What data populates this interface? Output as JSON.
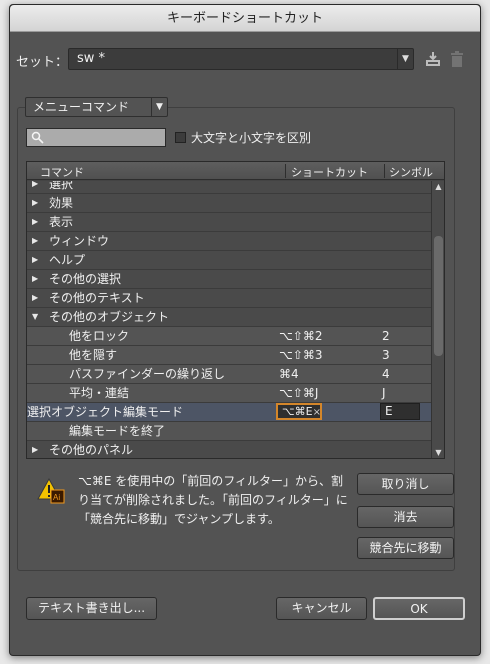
{
  "window": {
    "title": "キーボードショートカット"
  },
  "set": {
    "label": "セット：",
    "value": "sw *"
  },
  "menu_dropdown": {
    "value": "メニューコマンド"
  },
  "search": {
    "placeholder": ""
  },
  "case_checkbox": {
    "label": "大文字と小文字を区別",
    "checked": false
  },
  "table": {
    "headers": {
      "command": "コマンド",
      "shortcut": "ショートカット",
      "symbol": "シンボル"
    },
    "rows": [
      {
        "kind": "cat",
        "expanded": false,
        "name": "選択",
        "shortcut": "",
        "symbol": ""
      },
      {
        "kind": "cat",
        "expanded": false,
        "name": "効果",
        "shortcut": "",
        "symbol": ""
      },
      {
        "kind": "cat",
        "expanded": false,
        "name": "表示",
        "shortcut": "",
        "symbol": ""
      },
      {
        "kind": "cat",
        "expanded": false,
        "name": "ウィンドウ",
        "shortcut": "",
        "symbol": ""
      },
      {
        "kind": "cat",
        "expanded": false,
        "name": "ヘルプ",
        "shortcut": "",
        "symbol": ""
      },
      {
        "kind": "cat",
        "expanded": false,
        "name": "その他の選択",
        "shortcut": "",
        "symbol": ""
      },
      {
        "kind": "cat",
        "expanded": false,
        "name": "その他のテキスト",
        "shortcut": "",
        "symbol": ""
      },
      {
        "kind": "cat",
        "expanded": true,
        "name": "その他のオブジェクト",
        "shortcut": "",
        "symbol": ""
      },
      {
        "kind": "item",
        "name": "他をロック",
        "shortcut": "⌥⇧⌘2",
        "symbol": "2"
      },
      {
        "kind": "item",
        "name": "他を隠す",
        "shortcut": "⌥⇧⌘3",
        "symbol": "3"
      },
      {
        "kind": "item",
        "name": "パスファインダーの繰り返し",
        "shortcut": "⌘4",
        "symbol": "4"
      },
      {
        "kind": "item",
        "name": "平均・連結",
        "shortcut": "⌥⇧⌘J",
        "symbol": "J"
      },
      {
        "kind": "sel",
        "name": "選択オブジェクト編集モード",
        "shortcut": "⌥⌘E",
        "symbol": "E"
      },
      {
        "kind": "item",
        "name": "編集モードを終了",
        "shortcut": "",
        "symbol": ""
      },
      {
        "kind": "cat",
        "expanded": false,
        "name": "その他のパネル",
        "shortcut": "",
        "symbol": ""
      }
    ]
  },
  "warning": {
    "text": "⌥⌘E を使用中の「前回のフィルター」から、割り当てが削除されました。「前回のフィルター」に「競合先に移動」でジャンプします。"
  },
  "buttons": {
    "undo": "取り消し",
    "clear": "消去",
    "goto_conflict": "競合先に移動",
    "export_text": "テキスト書き出し...",
    "cancel": "キャンセル",
    "ok": "OK"
  },
  "colors": {
    "panel": "#535353",
    "selection": "#4d5565",
    "focus_border": "#d4862a",
    "warning_yellow": "#f2c200"
  }
}
